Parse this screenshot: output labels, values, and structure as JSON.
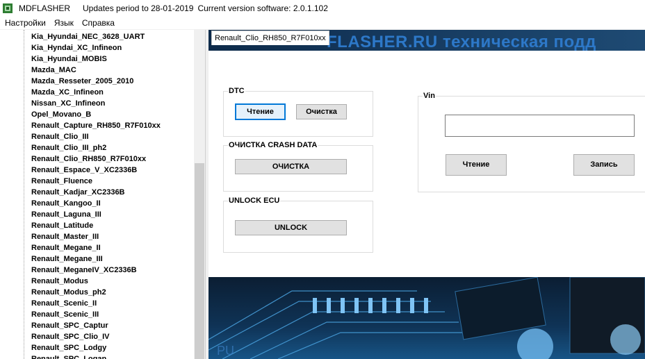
{
  "window": {
    "app_name": "MDFLASHER",
    "updates_text": "Updates period to 28-01-2019",
    "version_text": "Current version software: 2.0.1.102"
  },
  "menu": [
    "Настройки",
    "Язык",
    "Справка"
  ],
  "tree": {
    "items": [
      "Kia_Hyundai_NEC_3628_UART",
      "Kia_Hyndai_XC_Infineon",
      "Kia_Hyundai_MOBIS",
      "Mazda_MAC",
      "Mazda_Resseter_2005_2010",
      "Mazda_XC_Infineon",
      "Nissan_XC_Infineon",
      "Opel_Movano_B",
      "Renault_Capture_RH850_R7F010xx",
      "Renault_Clio_III",
      "Renault_Clio_III_ph2",
      "Renault_Clio_RH850_R7F010xx",
      "Renault_Espace_V_XC2336B",
      "Renault_Fluence",
      "Renault_Kadjar_XC2336B",
      "Renault_Kangoo_II",
      "Renault_Laguna_III",
      "Renault_Latitude",
      "Renault_Master_III",
      "Renault_Megane_II",
      "Renault_Megane_III",
      "Renault_MeganeIV_XC2336B",
      "Renault_Modus",
      "Renault_Modus_ph2",
      "Renault_Scenic_II",
      "Renault_Scenic_III",
      "Renault_SPC_Captur",
      "Renault_SPC_Clio_IV",
      "Renault_SPC_Lodgy",
      "Renault_SPC_Logan"
    ]
  },
  "banner": {
    "top_text": "FLASHER.RU техническая подд"
  },
  "tab": {
    "label": "Renault_Clio_RH850_R7F010xx"
  },
  "dtc": {
    "legend": "DTC",
    "read_label": "Чтение",
    "clear_label": "Очистка"
  },
  "crash": {
    "legend": "ОЧИСТКА CRASH DATA",
    "button_label": "ОЧИСТКА"
  },
  "unlock": {
    "legend": "UNLOCK ECU",
    "button_label": "UNLOCK"
  },
  "vin": {
    "legend": "Vin",
    "value": "",
    "read_label": "Чтение",
    "write_label": "Запись"
  },
  "colors": {
    "focus_border": "#0078d7",
    "button_face": "#e1e1e1",
    "banner_blue": "#2d78c8"
  }
}
